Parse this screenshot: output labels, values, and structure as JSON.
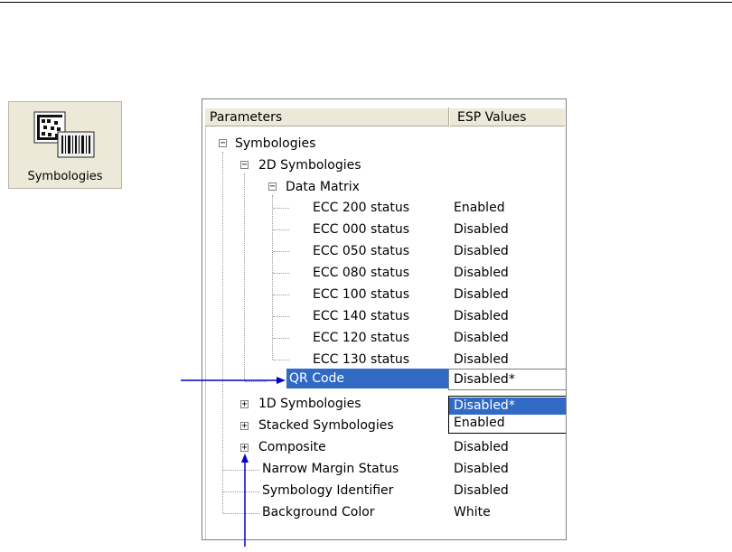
{
  "toolbar_button": {
    "label": "Symbologies",
    "icon": "symbologies-barcode-icon"
  },
  "columns": {
    "parameters": "Parameters",
    "esp_values": "ESP Values"
  },
  "tree": {
    "symbologies": "Symbologies",
    "two_d": "2D Symbologies",
    "data_matrix": "Data Matrix",
    "ecc": [
      {
        "name": "ECC 200 status",
        "value": "Enabled"
      },
      {
        "name": "ECC 000 status",
        "value": "Disabled"
      },
      {
        "name": "ECC 050 status",
        "value": "Disabled"
      },
      {
        "name": "ECC 080 status",
        "value": "Disabled"
      },
      {
        "name": "ECC 100 status",
        "value": "Disabled"
      },
      {
        "name": "ECC 140 status",
        "value": "Disabled"
      },
      {
        "name": "ECC 120 status",
        "value": "Disabled"
      },
      {
        "name": "ECC 130 status",
        "value": "Disabled"
      }
    ],
    "qr_code": "QR Code",
    "one_d": "1D Symbologies",
    "stacked": "Stacked Symbologies",
    "composite": {
      "name": "Composite",
      "value": "Disabled"
    },
    "narrow_margin": {
      "name": "Narrow Margin Status",
      "value": "Disabled"
    },
    "symbology_identifier": {
      "name": "Symbology Identifier",
      "value": "Disabled"
    },
    "background_color": {
      "name": "Background Color",
      "value": "White"
    }
  },
  "qr_dropdown": {
    "current": "Disabled*",
    "options": [
      "Disabled*",
      "Enabled"
    ]
  },
  "colors": {
    "selection": "#316ac5",
    "arrow": "#0000cc"
  }
}
